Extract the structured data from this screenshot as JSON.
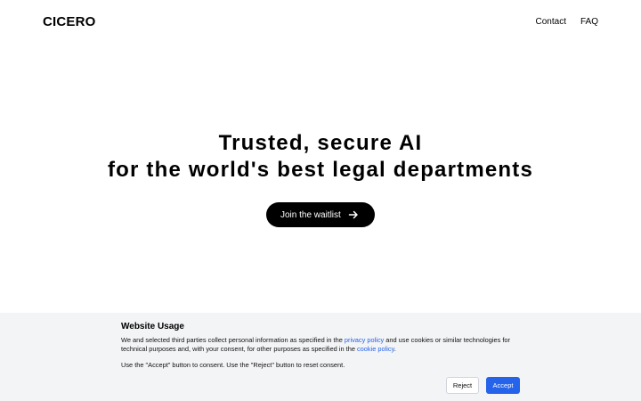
{
  "header": {
    "logo": "CICERO",
    "nav": [
      {
        "label": "Contact"
      },
      {
        "label": "FAQ"
      }
    ]
  },
  "hero": {
    "line1": "Trusted, secure AI",
    "line2": "for the world's best legal departments",
    "cta_label": "Join the waitlist",
    "cta_icon": "arrow-right-icon"
  },
  "cookie": {
    "title": "Website Usage",
    "p1_part1": "We and selected third parties collect personal information as specified in the ",
    "privacy_link": "privacy policy",
    "p1_part2": " and use cookies or similar technologies for technical purposes and, with your consent, for other purposes as specified in the ",
    "cookie_link": "cookie policy",
    "p1_part3": ".",
    "p2": "Use the \"Accept\" button to consent. Use the \"Reject\" button to reset consent.",
    "reject_label": "Reject",
    "accept_label": "Accept",
    "accent_color": "#2563eb",
    "banner_bg": "#f3f4f6"
  }
}
